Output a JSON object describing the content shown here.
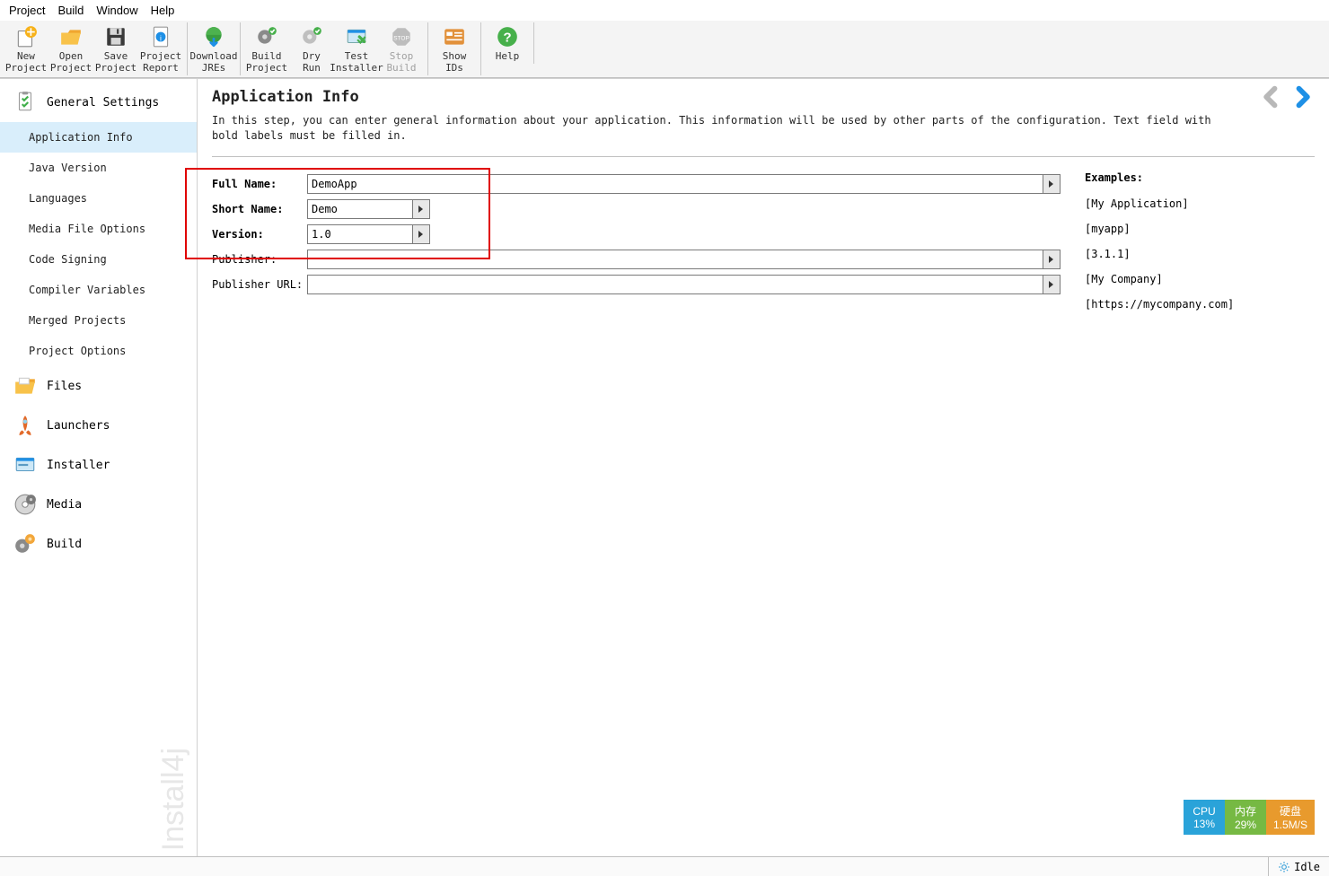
{
  "menubar": [
    "Project",
    "Build",
    "Window",
    "Help"
  ],
  "toolbar": {
    "groups": [
      [
        {
          "label": "New\nProject",
          "icon": "new-project-icon"
        },
        {
          "label": "Open\nProject",
          "icon": "open-project-icon"
        },
        {
          "label": "Save\nProject",
          "icon": "save-project-icon"
        },
        {
          "label": "Project\nReport",
          "icon": "project-report-icon"
        }
      ],
      [
        {
          "label": "Download\nJREs",
          "icon": "download-jres-icon"
        }
      ],
      [
        {
          "label": "Build\nProject",
          "icon": "build-project-icon"
        },
        {
          "label": "Dry\nRun",
          "icon": "dry-run-icon"
        },
        {
          "label": "Test\nInstaller",
          "icon": "test-installer-icon"
        },
        {
          "label": "Stop\nBuild",
          "icon": "stop-build-icon",
          "disabled": true
        }
      ],
      [
        {
          "label": "Show\nIDs",
          "icon": "show-ids-icon"
        }
      ],
      [
        {
          "label": "Help",
          "icon": "help-icon"
        }
      ]
    ]
  },
  "sidebar": {
    "sections": [
      {
        "label": "General Settings",
        "icon": "general-settings-icon",
        "items": [
          {
            "label": "Application Info",
            "selected": true
          },
          {
            "label": "Java Version"
          },
          {
            "label": "Languages"
          },
          {
            "label": "Media File Options"
          },
          {
            "label": "Code Signing"
          },
          {
            "label": "Compiler Variables"
          },
          {
            "label": "Merged Projects"
          },
          {
            "label": "Project Options"
          }
        ]
      },
      {
        "label": "Files",
        "icon": "files-icon"
      },
      {
        "label": "Launchers",
        "icon": "launchers-icon"
      },
      {
        "label": "Installer",
        "icon": "installer-icon"
      },
      {
        "label": "Media",
        "icon": "media-icon"
      },
      {
        "label": "Build",
        "icon": "build-icon"
      }
    ],
    "watermark": "Install4j"
  },
  "content": {
    "title": "Application Info",
    "desc": "In this step, you can enter general information about your application. This information will be used by other parts of the configuration. Text field with bold labels must be filled in.",
    "examples_title": "Examples:",
    "fields": [
      {
        "label": "Full Name:",
        "bold": true,
        "value": "DemoApp",
        "wide": true,
        "example": "[My Application]",
        "menu": true
      },
      {
        "label": "Short Name:",
        "bold": true,
        "value": "Demo",
        "wide": false,
        "example": "[myapp]",
        "menu": true
      },
      {
        "label": "Version:",
        "bold": true,
        "value": "1.0",
        "wide": false,
        "example": "[3.1.1]",
        "menu": true
      },
      {
        "label": "Publisher:",
        "bold": false,
        "value": "",
        "wide": true,
        "example": "[My Company]",
        "menu": true
      },
      {
        "label": "Publisher URL:",
        "bold": false,
        "value": "",
        "wide": true,
        "example": "[https://mycompany.com]",
        "menu": true
      }
    ]
  },
  "statusbar": {
    "idle": "Idle"
  },
  "perf": {
    "cpu_label": "CPU",
    "cpu_value": "13%",
    "mem_label": "内存",
    "mem_value": "29%",
    "disk_label": "硬盘",
    "disk_value": "1.5M/S",
    "colors": {
      "cpu": "#2aa3d9",
      "mem": "#76b943",
      "disk": "#e89a2d"
    }
  }
}
